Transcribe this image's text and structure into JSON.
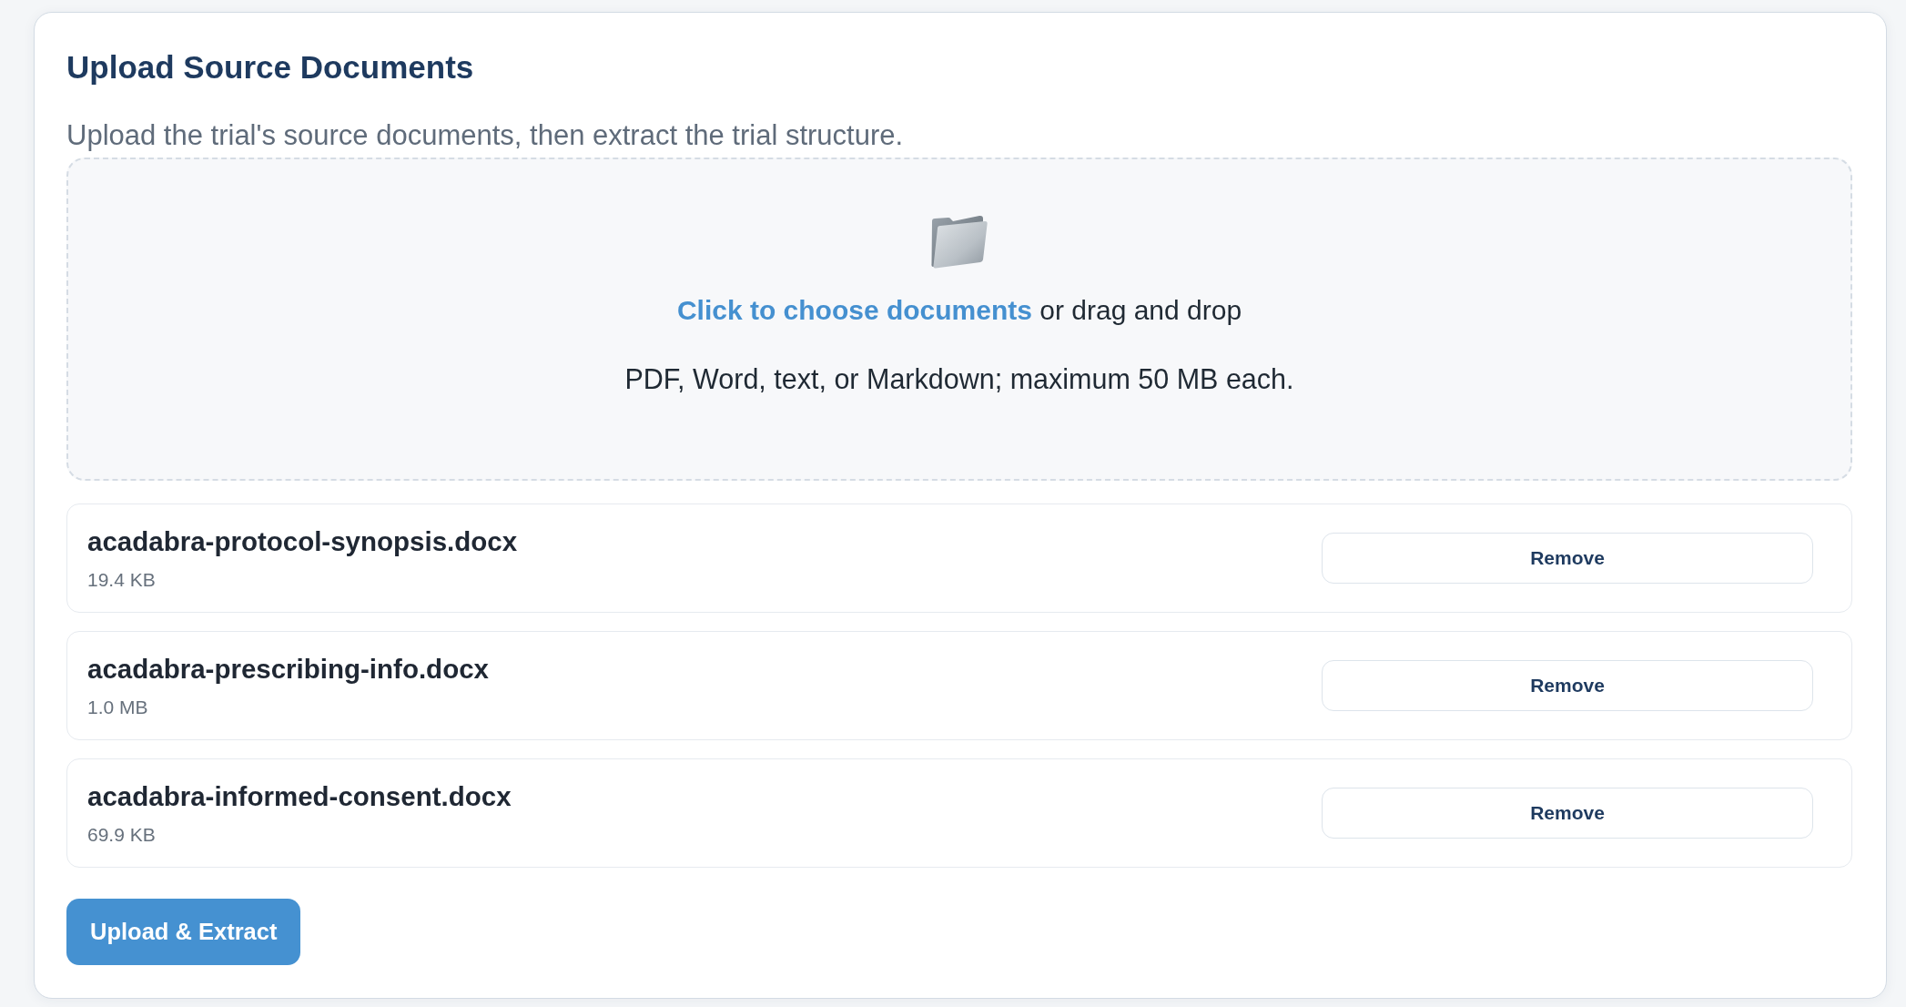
{
  "card": {
    "title": "Upload Source Documents",
    "description": "Upload the trial's source documents, then extract the trial structure."
  },
  "dropzone": {
    "link": "Click to choose documents",
    "text": "or drag and drop",
    "hint": "PDF, Word, text, or Markdown; maximum 50 MB each."
  },
  "files": [
    {
      "name": "acadabra-protocol-synopsis.docx",
      "size": "19.4 KB",
      "action": "Remove"
    },
    {
      "name": "acadabra-prescribing-info.docx",
      "size": "1.0 MB",
      "action": "Remove"
    },
    {
      "name": "acadabra-informed-consent.docx",
      "size": "69.9 KB",
      "action": "Remove"
    }
  ],
  "primary_button": "Upload & Extract"
}
